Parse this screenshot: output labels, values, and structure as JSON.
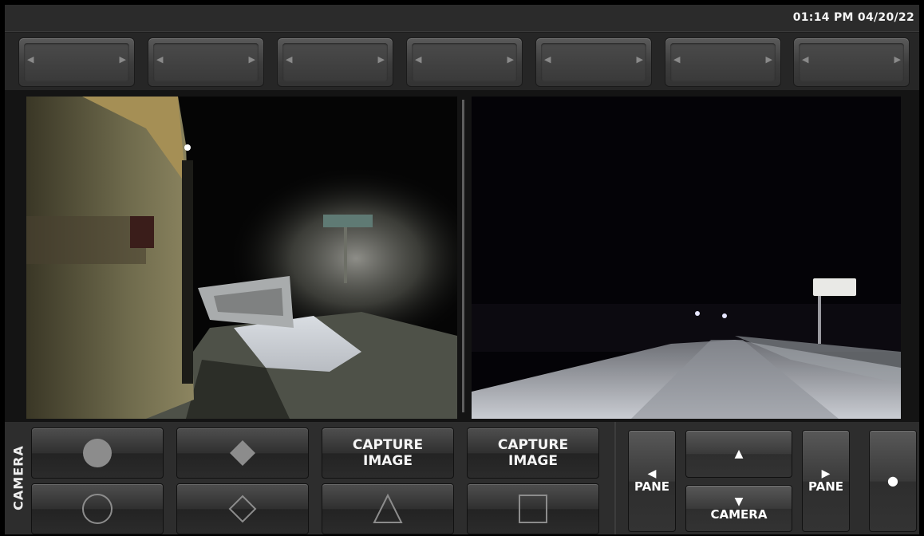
{
  "status_bar": {
    "datetime": "01:14 PM 04/20/22"
  },
  "selectors": [
    {
      "left_arrow": "◀",
      "right_arrow": "▶"
    },
    {
      "left_arrow": "◀",
      "right_arrow": "▶"
    },
    {
      "left_arrow": "◀",
      "right_arrow": "▶"
    },
    {
      "left_arrow": "◀",
      "right_arrow": "▶"
    },
    {
      "left_arrow": "◀",
      "right_arrow": "▶"
    },
    {
      "left_arrow": "◀",
      "right_arrow": "▶"
    },
    {
      "left_arrow": "◀",
      "right_arrow": "▶"
    }
  ],
  "camera_panel": {
    "label": "CAMERA",
    "row1": [
      {
        "icon": "filled-circle-icon"
      },
      {
        "icon": "filled-diamond-icon"
      },
      {
        "line1": "CAPTURE",
        "line2": "IMAGE"
      },
      {
        "line1": "CAPTURE",
        "line2": "IMAGE"
      }
    ],
    "row2": [
      {
        "icon": "circle-outline-icon"
      },
      {
        "icon": "diamond-outline-icon"
      },
      {
        "icon": "triangle-outline-icon"
      },
      {
        "icon": "square-outline-icon"
      }
    ]
  },
  "navigation": {
    "pane_prev": {
      "glyph": "◀",
      "label": "PANE"
    },
    "camera_up": {
      "glyph": "▲"
    },
    "camera_down": {
      "glyph": "▼",
      "label": "CAMERA"
    },
    "pane_next": {
      "glyph": "▶",
      "label": "PANE"
    },
    "record": {
      "glyph": "●"
    }
  },
  "colors": {
    "accent": "#f4f4f4",
    "button_shape": "#8c8c8c",
    "background": "#1d1d1d"
  }
}
